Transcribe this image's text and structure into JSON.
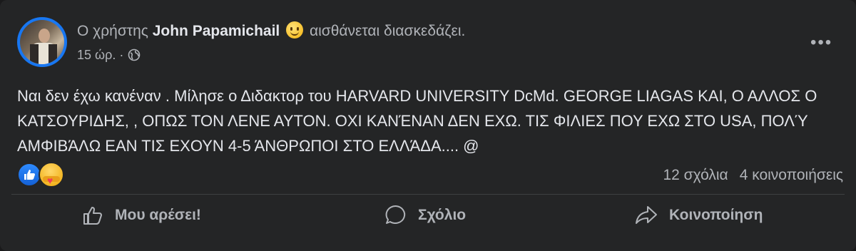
{
  "post": {
    "prefix": "Ο χρήστης",
    "author": "John Papamichail",
    "feeling_icon": "slightly-smiling-emoji",
    "feeling": "αισθάνεται διασκεδάζει.",
    "time": "15 ώρ. ·",
    "privacy_icon": "globe-icon",
    "more_label": "•••",
    "text": "Ναι δεν έχω κανέναν . Μίλησε ο Διδακτορ του HARVARD UNIVERSITY DcMd. GEORGE LIAGAS ΚΑΙ, Ο ΑΛΛΟΣ Ο ΚΑΤΣΟΥΡΙΔΗΣ, , ΟΠΩΣ ΤΟΝ ΛΕΝΕ ΑΥΤΟΝ. ΟΧΙ ΚΑΝΈΝΑΝ ΔΕΝ ΕΧΩ. ΤΙΣ ΦΙΛΙΕΣ ΠΟΥ ΕΧΩ ΣΤΟ USA, ΠΟΛΎ ΑΜΦΙΒΆΛΩ ΕΑΝ ΤΙΣ ΕΧΟΥΝ 4-5 ΆΝΘΡΩΠΟΙ ΣΤΟ ΕΛΛΆΔΑ.... @"
  },
  "stats": {
    "reaction_icons": [
      "like-reaction-icon",
      "care-reaction-icon"
    ],
    "comments": "12 σχόλια",
    "shares": "4 κοινοποιήσεις"
  },
  "actions": {
    "like": "Μου αρέσει!",
    "comment": "Σχόλιο",
    "share": "Κοινοποίηση"
  },
  "colors": {
    "card_bg": "#242526",
    "text_primary": "#e4e6eb",
    "text_secondary": "#b0b3b8",
    "like_blue": "#1877f2"
  }
}
